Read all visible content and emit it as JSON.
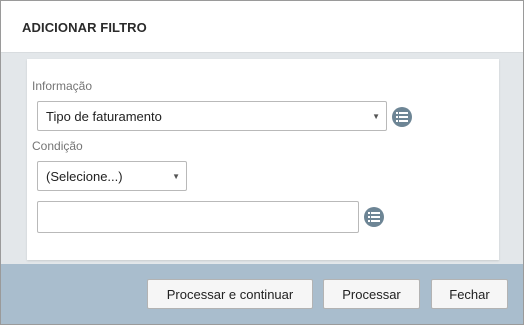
{
  "dialog": {
    "title": "ADICIONAR FILTRO"
  },
  "form": {
    "info_label": "Informação",
    "info_select_value": "Tipo de faturamento",
    "condition_label": "Condição",
    "condition_select_value": "(Selecione...)",
    "value_input": ""
  },
  "icons": {
    "list_button": "list-icon",
    "dropdown_caret": "caret-down-icon"
  },
  "footer": {
    "process_continue_label": "Processar e continuar",
    "process_label": "Processar",
    "close_label": "Fechar"
  },
  "colors": {
    "footer_bg": "#a9bdcd",
    "body_bg": "#e3e7ea",
    "list_icon_bg": "#6d8595"
  }
}
